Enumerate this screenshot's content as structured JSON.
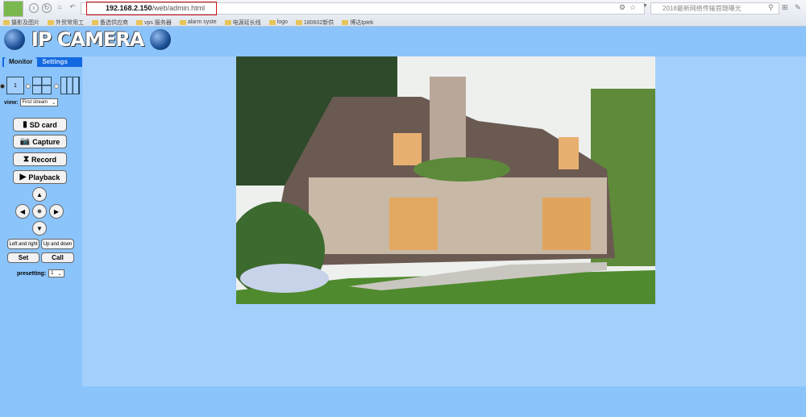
{
  "browser": {
    "url_host": "192.168.2.150",
    "url_path": "/web/admin.html",
    "search_placeholder": "2018最新网络传输首题曝光",
    "bookmarks": [
      "摄影及图片",
      "外贸常用工",
      "备选供应商",
      "vps 服务器",
      "alarm syste",
      "电源延长线",
      "logo",
      "180602新供",
      "博达tptek"
    ]
  },
  "header": {
    "title": "IP CAMERA"
  },
  "tabs": [
    {
      "label": "Monitor",
      "active": true
    },
    {
      "label": "Settings",
      "active": false
    }
  ],
  "split": {
    "single_label": "1",
    "selected": "1"
  },
  "view": {
    "label": "view:",
    "value": "First stream"
  },
  "actions": {
    "sd_card": "SD card",
    "capture": "Capture",
    "record": "Record",
    "playback": "Playback"
  },
  "ptz": {
    "left_right": "Left and right",
    "up_down": "Up and down",
    "set": "Set",
    "call": "Call"
  },
  "preset": {
    "label": "presetting:",
    "value": "1"
  },
  "colors": {
    "page_bg": "#8bc4fb",
    "main_bg": "#a3cffd",
    "tab_bar": "#1569e0",
    "url_highlight": "#d01010"
  }
}
